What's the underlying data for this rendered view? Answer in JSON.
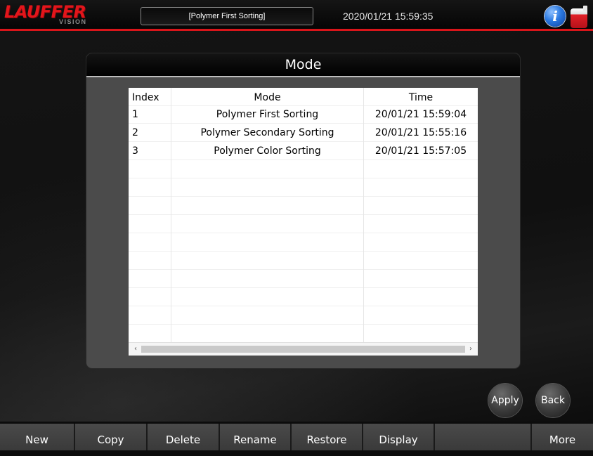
{
  "header": {
    "logo_text": "LAUFFER",
    "logo_subtext": "VISION",
    "current_mode": "[Polymer First Sorting]",
    "datetime": "2020/01/21 15:59:35",
    "info_icon": "info-icon",
    "exit_icon": "exit-icon",
    "accent_color": "#d9151a"
  },
  "dialog": {
    "title": "Mode",
    "columns": [
      "Index",
      "Mode",
      "Time"
    ],
    "rows": [
      {
        "index": "1",
        "mode": "Polymer First Sorting",
        "time": "20/01/21 15:59:04"
      },
      {
        "index": "2",
        "mode": "Polymer Secondary Sorting",
        "time": "20/01/21 15:55:16"
      },
      {
        "index": "3",
        "mode": "Polymer Color Sorting",
        "time": "20/01/21 15:57:05"
      }
    ],
    "scroll_left": "‹",
    "scroll_right": "›"
  },
  "actions": {
    "apply": "Apply",
    "back": "Back"
  },
  "toolbar": {
    "buttons": [
      "New",
      "Copy",
      "Delete",
      "Rename",
      "Restore",
      "Display",
      "",
      "More"
    ]
  }
}
